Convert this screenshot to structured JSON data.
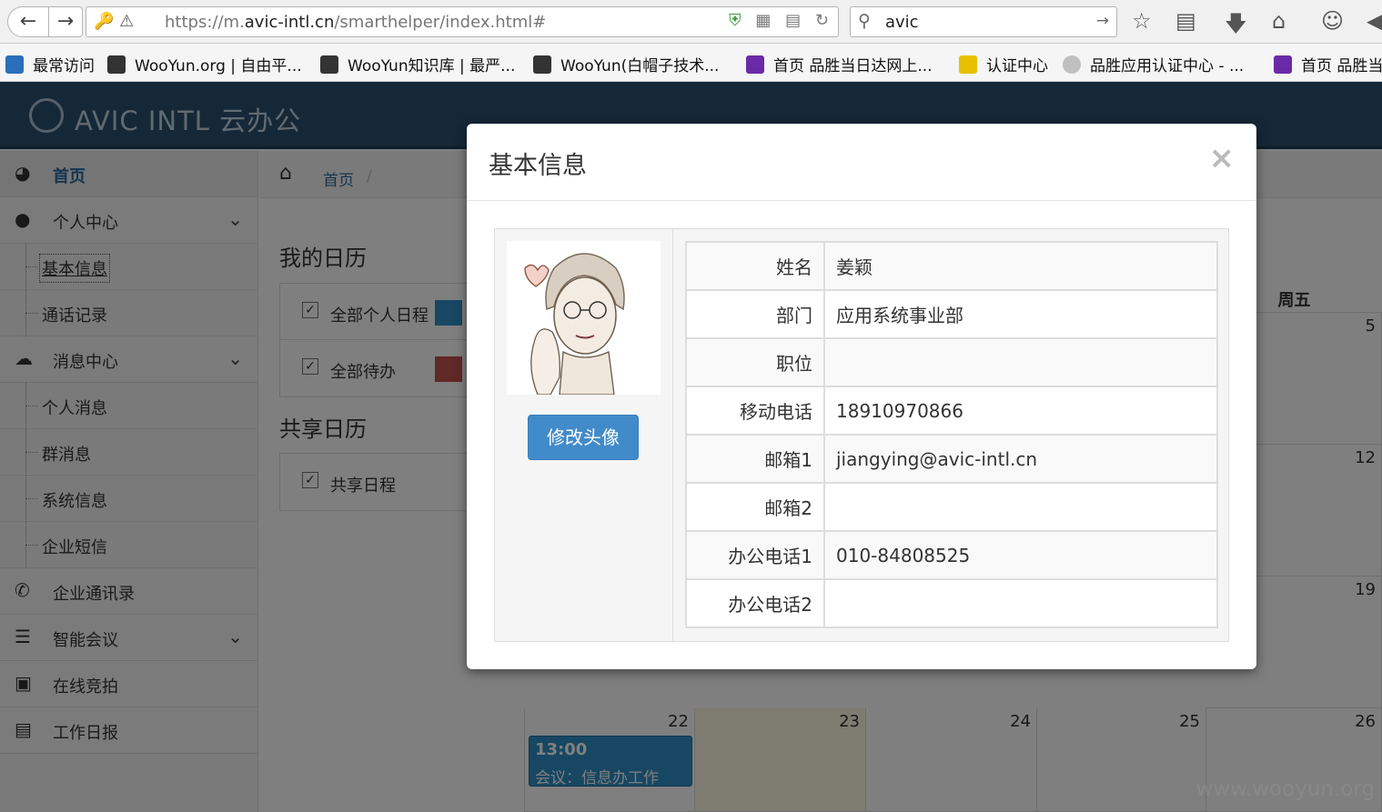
{
  "browser": {
    "url_prefix": "https://m.",
    "url_domain": "avic-intl.cn",
    "url_path": "/smarthelper/index.html#",
    "search_value": "avic",
    "bookmarks": [
      {
        "label": "最常访问",
        "color": "#2a6fb8"
      },
      {
        "label": "WooYun.org | 自由平...",
        "color": "#333333"
      },
      {
        "label": "WooYun知识库 | 最严...",
        "color": "#333333"
      },
      {
        "label": "WooYun(白帽子技术...",
        "color": "#333333"
      },
      {
        "label": "首页 品胜当日达网上...",
        "color": "#6a2aa8"
      },
      {
        "label": "认证中心",
        "color": "#e8c000"
      },
      {
        "label": "品胜应用认证中心 - ...",
        "color": "#c0c0c0"
      },
      {
        "label": "首页 品胜当",
        "color": "#6a2aa8"
      }
    ]
  },
  "header": {
    "logo_text": "AVIC INTL 云办公"
  },
  "sidebar": {
    "items": [
      {
        "label": "首页",
        "icon": "dashboard-icon",
        "glyph": "◕"
      },
      {
        "label": "个人中心",
        "icon": "user-icon",
        "glyph": "●"
      },
      {
        "label": "基本信息"
      },
      {
        "label": "通话记录"
      },
      {
        "label": "消息中心",
        "icon": "comments-icon",
        "glyph": "☁"
      },
      {
        "label": "个人消息"
      },
      {
        "label": "群消息"
      },
      {
        "label": "系统信息"
      },
      {
        "label": "企业短信"
      },
      {
        "label": "企业通讯录",
        "icon": "phone-icon",
        "glyph": "✆"
      },
      {
        "label": "智能会议",
        "icon": "list-icon",
        "glyph": "☰"
      },
      {
        "label": "在线竞拍",
        "icon": "gift-icon",
        "glyph": "▣"
      },
      {
        "label": "工作日报",
        "icon": "book-icon",
        "glyph": "▤"
      }
    ]
  },
  "breadcrumb": {
    "home": "首页",
    "sep": "/"
  },
  "calendar_panel": {
    "my_title": "我的日历",
    "filters": [
      {
        "label": "全部个人日程",
        "color": "#2e8ec4"
      },
      {
        "label": "全部待办",
        "color": "#c0504d"
      }
    ],
    "shared_title": "共享日历",
    "shared_filters": [
      {
        "label": "共享日程"
      }
    ]
  },
  "calendar": {
    "friday_header": "周五",
    "week1": [
      "5"
    ],
    "week2": [
      "12"
    ],
    "week3": [
      "19"
    ],
    "week4": [
      "22",
      "23",
      "24",
      "25",
      "26"
    ],
    "event": {
      "time": "13:00",
      "title": "会议：信息办工作"
    }
  },
  "modal": {
    "title": "基本信息",
    "close": "×",
    "change_avatar": "修改头像",
    "fields": [
      {
        "label": "姓名",
        "value": "姜颖"
      },
      {
        "label": "部门",
        "value": "应用系统事业部"
      },
      {
        "label": "职位",
        "value": ""
      },
      {
        "label": "移动电话",
        "value": "18910970866"
      },
      {
        "label": "邮箱1",
        "value": "jiangying@avic-intl.cn"
      },
      {
        "label": "邮箱2",
        "value": ""
      },
      {
        "label": "办公电话1",
        "value": "010-84808525"
      },
      {
        "label": "办公电话2",
        "value": ""
      }
    ]
  },
  "watermark": "www.wooyun.org"
}
